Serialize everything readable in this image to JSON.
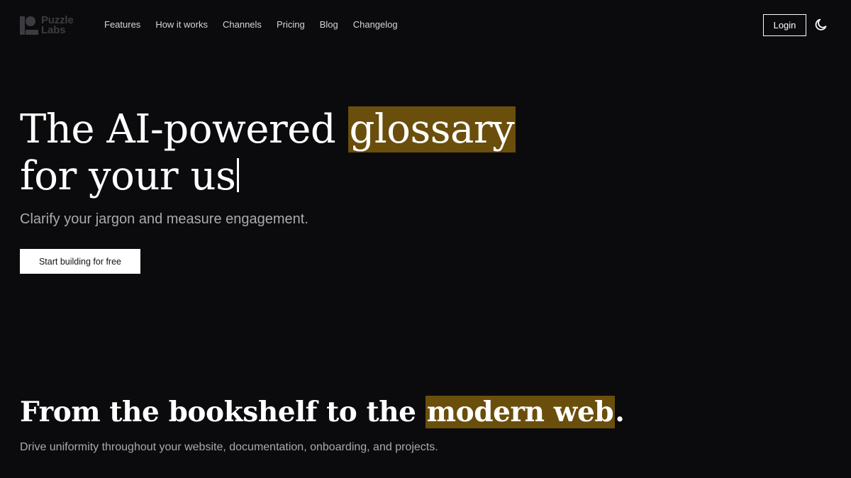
{
  "brand": {
    "logo_line1": "Puzzle",
    "logo_line2": "Labs"
  },
  "nav": {
    "items": [
      "Features",
      "How it works",
      "Channels",
      "Pricing",
      "Blog",
      "Changelog"
    ]
  },
  "header": {
    "login_label": "Login",
    "theme_icon": "moon-icon"
  },
  "hero": {
    "title_part1": "The AI-powered ",
    "title_highlight": "glossary",
    "title_line2": "for your us",
    "subtitle": "Clarify your jargon and measure engagement.",
    "cta_label": "Start building for free"
  },
  "section": {
    "title_part1": "From the bookshelf to the ",
    "title_highlight": "modern web",
    "title_part2": ".",
    "subtitle": "Drive uniformity throughout your website, documentation, onboarding, and projects."
  },
  "colors": {
    "background": "#0b0b0d",
    "highlight": "#6a4e0b",
    "text": "#ffffff",
    "muted_text": "#a9a9b0"
  }
}
